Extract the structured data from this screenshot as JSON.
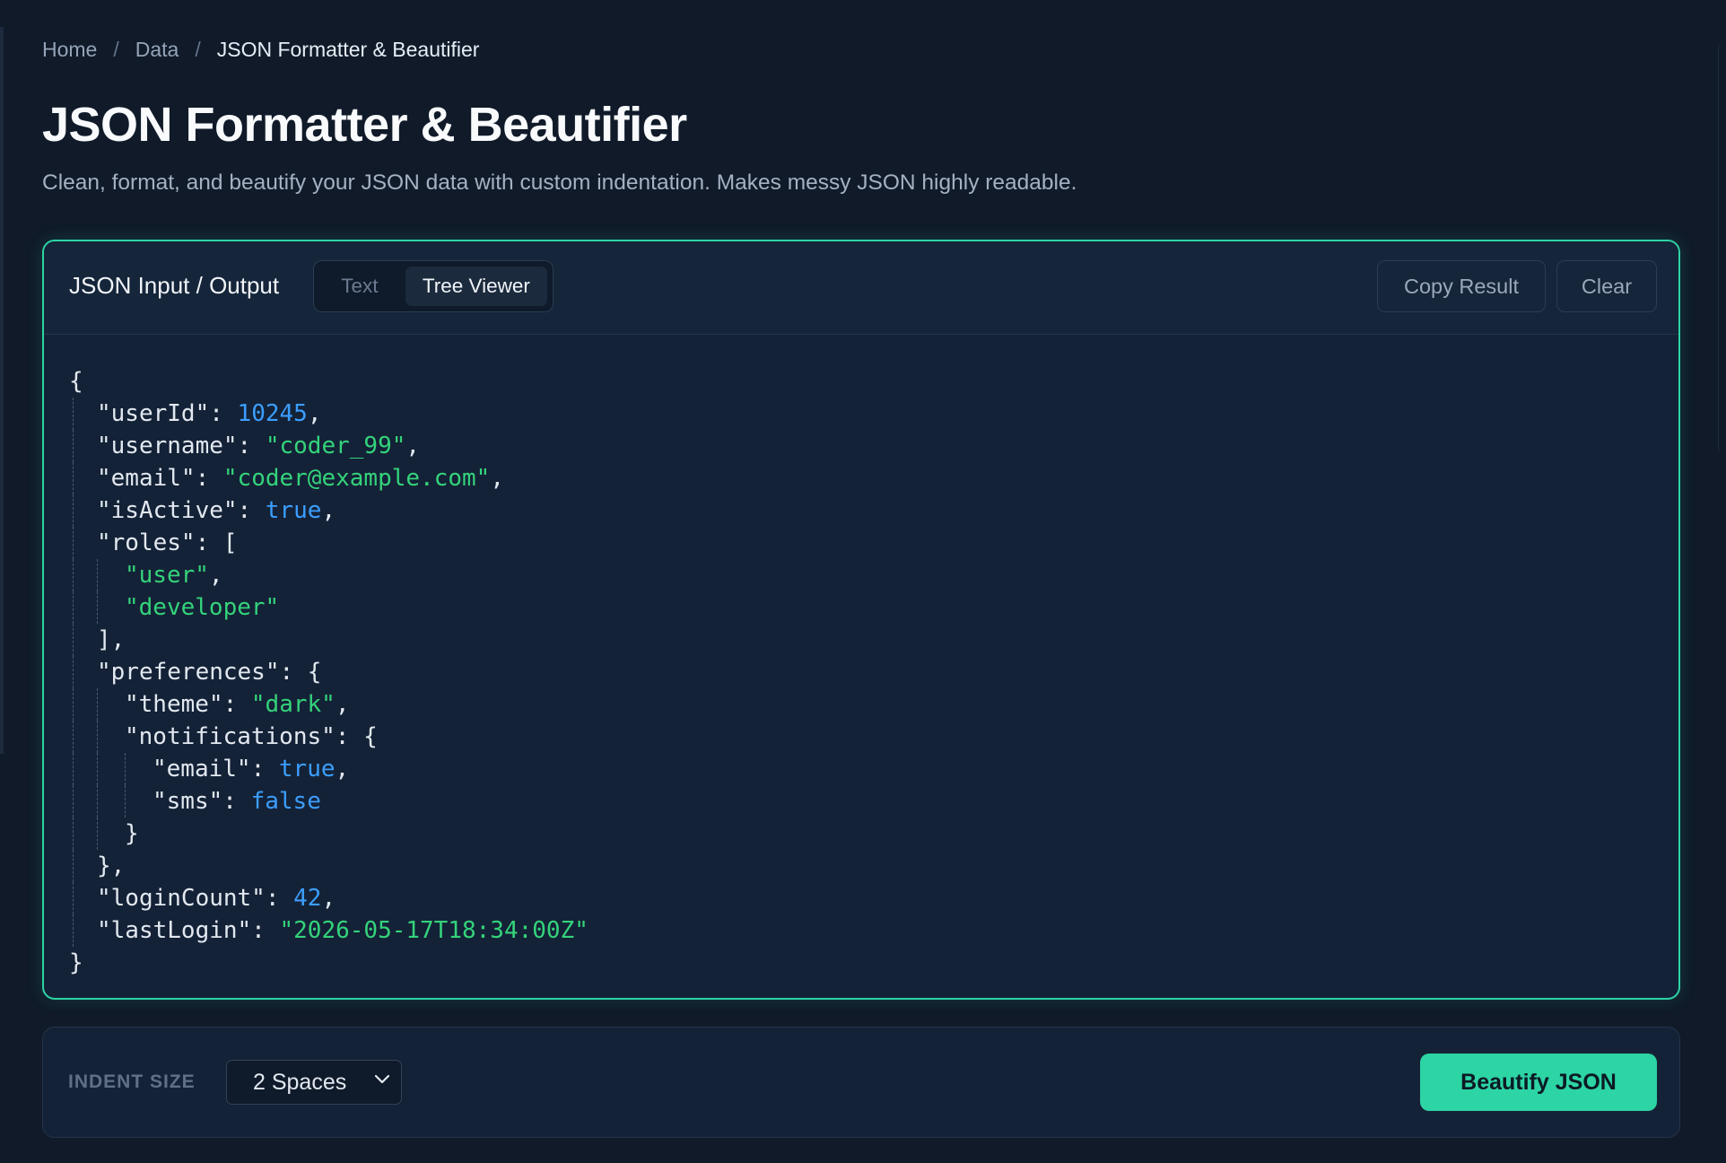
{
  "breadcrumb": {
    "items": [
      "Home",
      "Data",
      "JSON Formatter & Beautifier"
    ],
    "separator": "/"
  },
  "page": {
    "title": "JSON Formatter & Beautifier",
    "subtitle": "Clean, format, and beautify your JSON data with custom indentation. Makes messy JSON highly readable."
  },
  "editor": {
    "title": "JSON Input / Output",
    "tabs": [
      {
        "label": "Text",
        "active": false
      },
      {
        "label": "Tree Viewer",
        "active": true
      }
    ],
    "copy_label": "Copy Result",
    "clear_label": "Clear",
    "code_lines": [
      "{",
      "  \"userId\": 10245,",
      "  \"username\": \"coder_99\",",
      "  \"email\": \"coder@example.com\",",
      "  \"isActive\": true,",
      "  \"roles\": [",
      "    \"user\",",
      "    \"developer\"",
      "  ],",
      "  \"preferences\": {",
      "    \"theme\": \"dark\",",
      "    \"notifications\": {",
      "      \"email\": true,",
      "      \"sms\": false",
      "    }",
      "  },",
      "  \"loginCount\": 42,",
      "  \"lastLogin\": \"2026-05-17T18:34:00Z\"",
      "}"
    ]
  },
  "controls": {
    "indent_label": "INDENT SIZE",
    "indent_value": "2 Spaces",
    "beautify_label": "Beautify JSON"
  },
  "colors": {
    "accent": "#2dd4a4",
    "string": "#34d37b",
    "number": "#3b9eff",
    "background": "#101a29",
    "card": "#142237"
  }
}
